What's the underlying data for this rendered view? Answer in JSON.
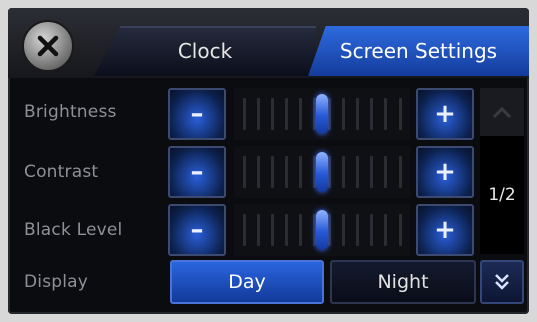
{
  "tabs": {
    "clock": "Clock",
    "screen_settings": "Screen Settings"
  },
  "icons": {
    "close": "close-icon",
    "up": "chevron-up-icon",
    "down": "double-chevron-down-icon"
  },
  "settings": {
    "brightness": {
      "label": "Brightness",
      "minus": "–",
      "plus": "+",
      "level": 0.5
    },
    "contrast": {
      "label": "Contrast",
      "minus": "–",
      "plus": "+",
      "level": 0.5
    },
    "black_level": {
      "label": "Black Level",
      "minus": "–",
      "plus": "+",
      "level": 0.5
    }
  },
  "display": {
    "label": "Display",
    "day": "Day",
    "night": "Night",
    "selected": "Day"
  },
  "pager": {
    "indicator": "1/2"
  },
  "colors": {
    "accent": "#2a65df",
    "background": "#0b0c10"
  }
}
